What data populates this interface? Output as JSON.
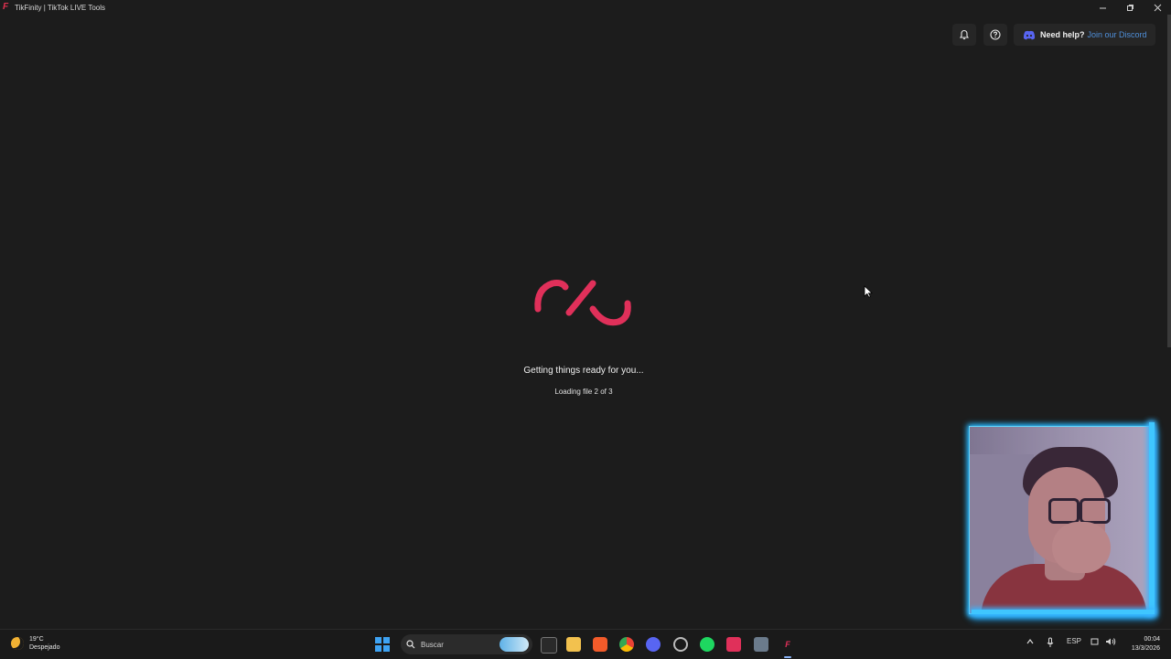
{
  "window": {
    "title": "TikFinity | TikTok LIVE Tools",
    "logo_text": "F",
    "controls": [
      "minimize",
      "restore",
      "close"
    ]
  },
  "header": {
    "notification_icon": "bell-icon",
    "help_icon": "question-circle-icon",
    "help_label": "Need help?",
    "help_link": "Join our Discord"
  },
  "loading": {
    "title": "Getting things ready for you...",
    "subtitle": "Loading file 2 of 3",
    "accent_color": "#e0305a"
  },
  "taskbar": {
    "weather": {
      "temp": "19°C",
      "condition": "Despejado"
    },
    "search_placeholder": "Buscar",
    "apps": [
      "task-view",
      "file-explorer",
      "brave",
      "chrome",
      "discord",
      "app",
      "spotify",
      "tiktok",
      "app-store",
      "tikfinity"
    ],
    "tray": {
      "language": "ESP"
    },
    "clock": {
      "time": "00:04",
      "date": "13/3/2026"
    }
  }
}
